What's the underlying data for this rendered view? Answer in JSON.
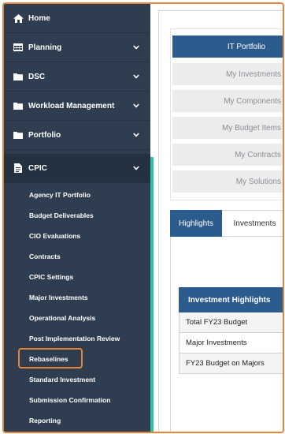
{
  "sidebar": {
    "items": [
      {
        "label": "Home",
        "icon": "home-icon"
      },
      {
        "label": "Planning",
        "icon": "table-icon"
      },
      {
        "label": "DSC",
        "icon": "folder-icon"
      },
      {
        "label": "Workload Management",
        "icon": "folder-icon"
      },
      {
        "label": "Portfolio",
        "icon": "folder-icon"
      },
      {
        "label": "CPIC",
        "icon": "document-icon"
      }
    ],
    "cpic_subitems": [
      "Agency IT Portfolio",
      "Budget Deliverables",
      "CIO Evaluations",
      "Contracts",
      "CPIC Settings",
      "Major Investments",
      "Operational Analysis",
      "Post Implementation Review",
      "Rebaselines",
      "Standard Investment",
      "Submission Confirmation",
      "Reporting"
    ],
    "highlighted_item": "Rebaselines"
  },
  "main": {
    "buttons": [
      "IT Portfolio",
      "My Investments",
      "My Components",
      "My Budget Items",
      "My Contracts",
      "My Solutions"
    ],
    "tabs": [
      "Highlights",
      "Investments"
    ],
    "highlights_table": {
      "header": "Investment Highlights",
      "rows": [
        "Total FY23 Budget",
        "Major Investments",
        "FY23 Budget on Majors"
      ]
    }
  },
  "colors": {
    "sidebar_bg": "#2e3e50",
    "accent": "#2fc5a4",
    "primary": "#2c5b8e",
    "highlight": "#e8843a"
  }
}
